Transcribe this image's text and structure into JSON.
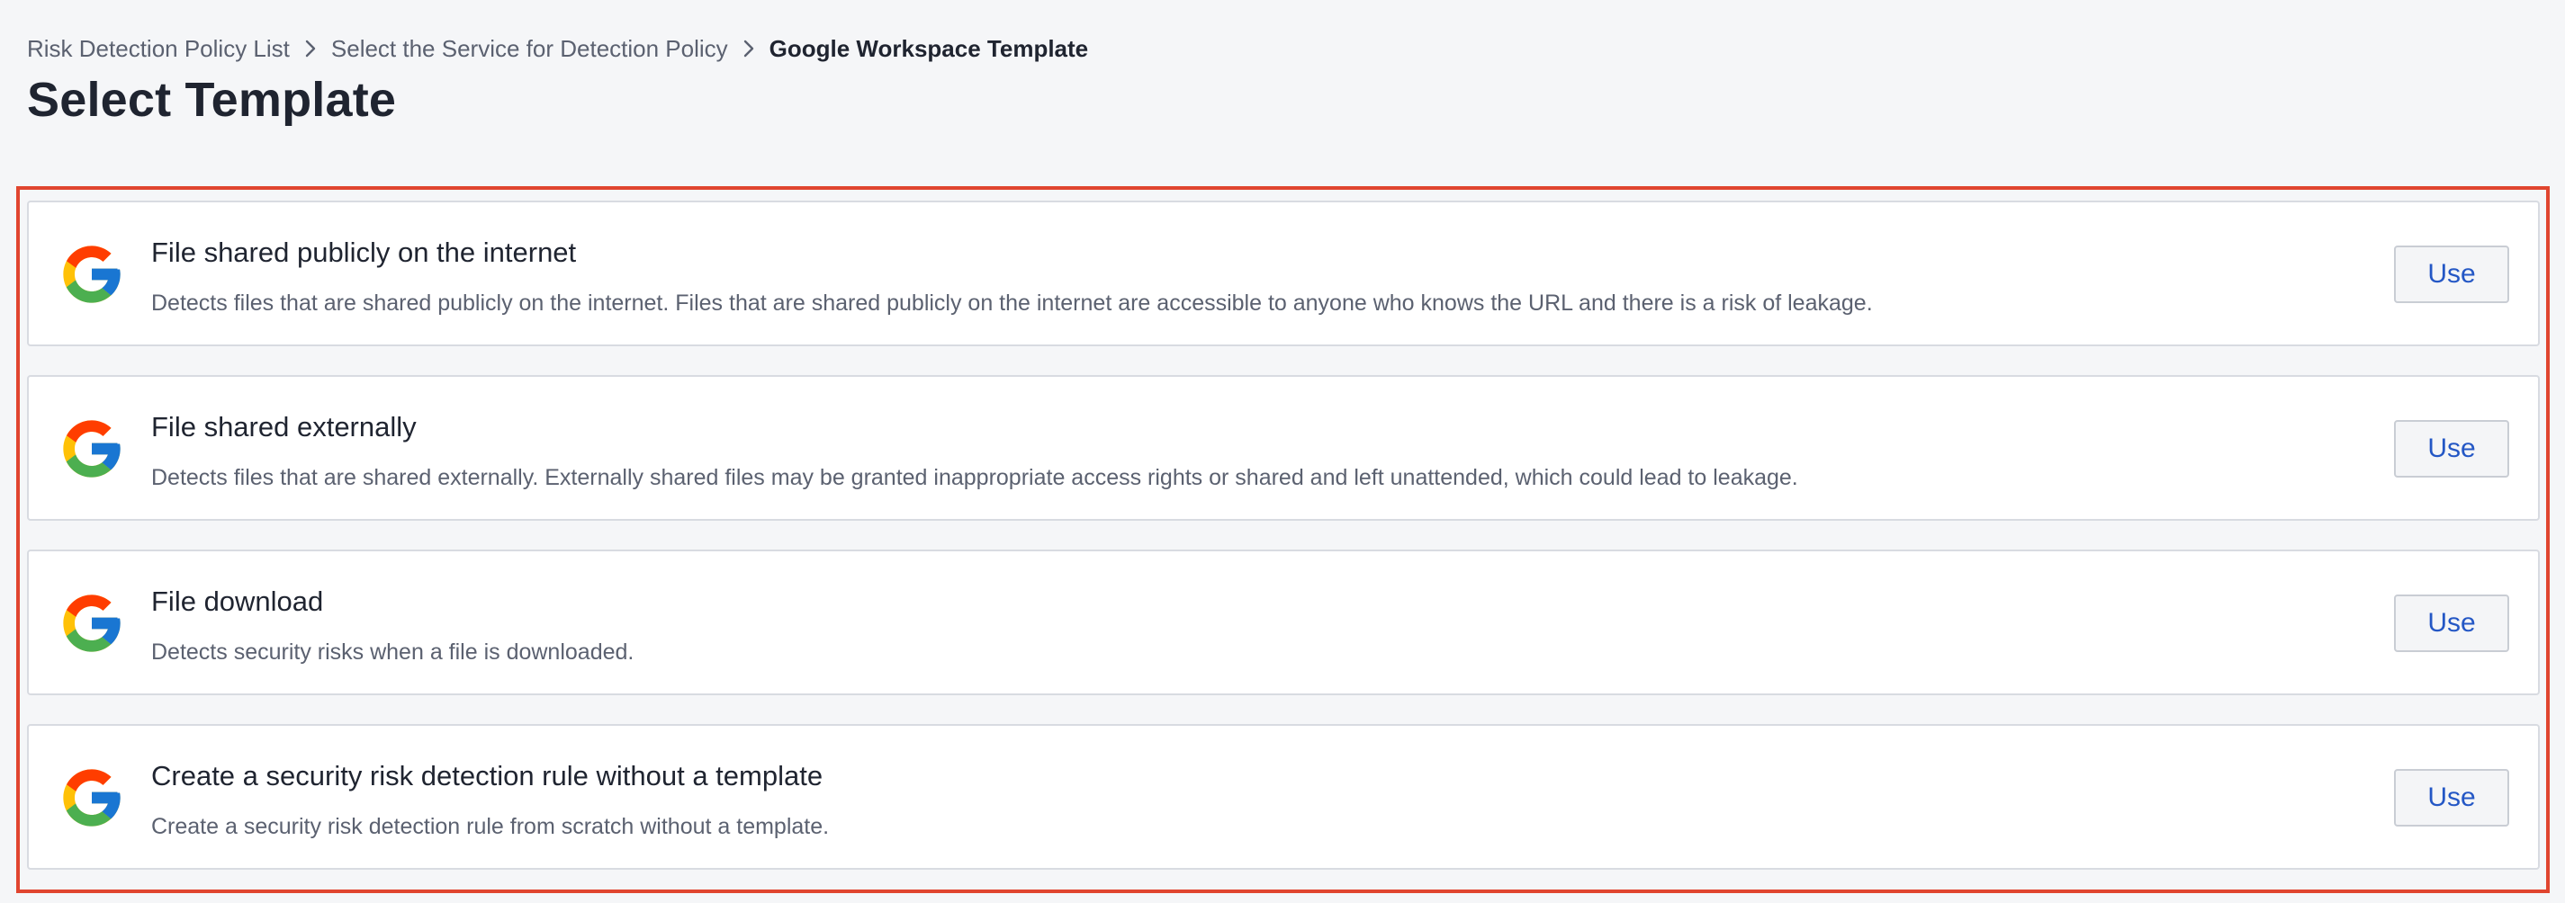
{
  "breadcrumb": {
    "items": [
      {
        "label": "Risk Detection Policy List"
      },
      {
        "label": "Select the Service for Detection Policy"
      },
      {
        "label": "Google Workspace Template"
      }
    ]
  },
  "page": {
    "title": "Select Template"
  },
  "colors": {
    "highlight_border": "#e0452f",
    "button_text": "#2457c5",
    "google_red": "#EA4335",
    "google_yellow": "#FBBC05",
    "google_green": "#34A853",
    "google_blue": "#4285F4"
  },
  "templates": [
    {
      "icon": "google-g-icon",
      "title": "File shared publicly on the internet",
      "description": "Detects files that are shared publicly on the internet. Files that are shared publicly on the internet are accessible to anyone who knows the URL and there is a risk of leakage.",
      "action_label": "Use"
    },
    {
      "icon": "google-g-icon",
      "title": "File shared externally",
      "description": "Detects files that are shared externally. Externally shared files may be granted inappropriate access rights or shared and left unattended, which could lead to leakage.",
      "action_label": "Use"
    },
    {
      "icon": "google-g-icon",
      "title": "File download",
      "description": "Detects security risks when a file is downloaded.",
      "action_label": "Use"
    },
    {
      "icon": "google-g-icon",
      "title": "Create a security risk detection rule without a template",
      "description": "Create a security risk detection rule from scratch without a template.",
      "action_label": "Use"
    }
  ]
}
